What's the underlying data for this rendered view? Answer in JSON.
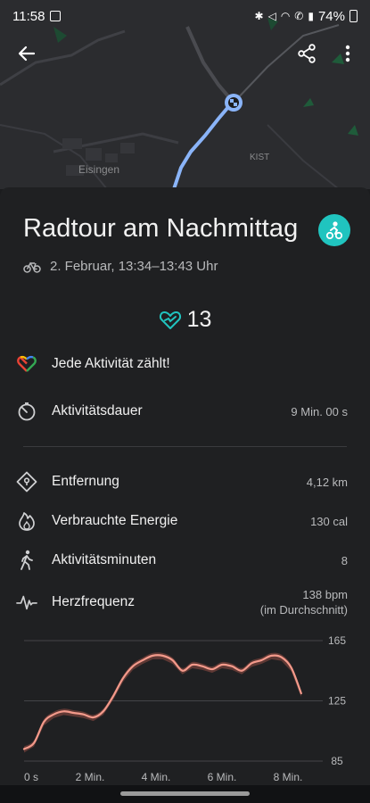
{
  "status_bar": {
    "time": "11:58",
    "battery": "74%"
  },
  "map": {
    "labels": [
      "Eisingen",
      "KIST"
    ],
    "route_color": "#8ab4f8"
  },
  "activity": {
    "title": "Radtour am Nachmittag",
    "date_range": "2. Februar, 13:34–13:43 Uhr",
    "heart_points": "13",
    "accent_color": "#20c4bf"
  },
  "move_banner": {
    "label": "Jede Aktivität zählt!"
  },
  "stats": {
    "duration": {
      "label": "Aktivitätsdauer",
      "value": "9 Min. 00 s"
    },
    "distance": {
      "label": "Entfernung",
      "value": "4,12 km"
    },
    "energy": {
      "label": "Verbrauchte Energie",
      "value": "130 cal"
    },
    "move_minutes": {
      "label": "Aktivitätsminuten",
      "value": "8"
    },
    "heart_rate": {
      "label": "Herzfrequenz",
      "value": "138 bpm",
      "note": "(im Durchschnitt)"
    }
  },
  "chart_data": {
    "type": "line",
    "title": "",
    "xlabel": "",
    "ylabel": "",
    "x_tick_labels": [
      "0 s",
      "2 Min.",
      "4 Min.",
      "6 Min.",
      "8 Min."
    ],
    "y_tick_labels": [
      "165",
      "125",
      "85"
    ],
    "ylim": [
      85,
      165
    ],
    "xlim": [
      0,
      9
    ],
    "grid": true,
    "series": [
      {
        "color": "#f39a8b",
        "x": [
          0,
          0.3,
          0.6,
          0.9,
          1.2,
          1.5,
          1.8,
          2.1,
          2.4,
          2.7,
          3.0,
          3.3,
          3.6,
          3.9,
          4.2,
          4.5,
          4.8,
          5.1,
          5.4,
          5.7,
          6.0,
          6.3,
          6.6,
          6.9,
          7.2,
          7.5,
          7.8,
          8.1,
          8.4
        ],
        "y": [
          93,
          97,
          111,
          116,
          118,
          117,
          116,
          114,
          118,
          128,
          140,
          148,
          152,
          155,
          155,
          152,
          145,
          149,
          148,
          146,
          149,
          148,
          145,
          150,
          152,
          155,
          154,
          147,
          130
        ]
      }
    ]
  }
}
